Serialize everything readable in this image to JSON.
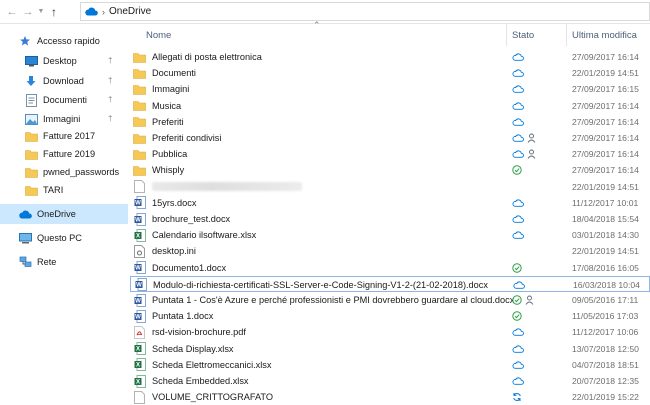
{
  "address": {
    "path": "OneDrive"
  },
  "sidebar": {
    "items": [
      {
        "label": "Accesso rapido",
        "icon": "star-icon"
      },
      {
        "label": "Desktop",
        "icon": "desktop-icon",
        "pinned": true
      },
      {
        "label": "Download",
        "icon": "download-icon",
        "pinned": true
      },
      {
        "label": "Documenti",
        "icon": "documents-icon",
        "pinned": true
      },
      {
        "label": "Immagini",
        "icon": "pictures-icon",
        "pinned": true
      },
      {
        "label": "Fatture 2017",
        "icon": "folder-icon"
      },
      {
        "label": "Fatture 2019",
        "icon": "folder-icon"
      },
      {
        "label": "pwned_passwords",
        "icon": "folder-icon"
      },
      {
        "label": "TARI",
        "icon": "folder-icon"
      },
      {
        "label": "OneDrive",
        "icon": "cloud-icon",
        "selected": true
      },
      {
        "label": "Questo PC",
        "icon": "computer-icon"
      },
      {
        "label": "Rete",
        "icon": "network-icon"
      }
    ]
  },
  "columns": {
    "name": "Nome",
    "state": "Stato",
    "modified": "Ultima modifica"
  },
  "files": [
    {
      "name": "Allegati di posta elettronica",
      "type": "folder",
      "state": [
        "cloud"
      ],
      "date": "27/09/2017 16:14"
    },
    {
      "name": "Documenti",
      "type": "folder",
      "state": [
        "cloud"
      ],
      "date": "22/01/2019 14:51"
    },
    {
      "name": "Immagini",
      "type": "folder",
      "state": [
        "cloud"
      ],
      "date": "27/09/2017 16:15"
    },
    {
      "name": "Musica",
      "type": "folder",
      "state": [
        "cloud"
      ],
      "date": "27/09/2017 16:14"
    },
    {
      "name": "Preferiti",
      "type": "folder",
      "state": [
        "cloud"
      ],
      "date": "27/09/2017 16:14"
    },
    {
      "name": "Preferiti condivisi",
      "type": "folder",
      "state": [
        "cloud",
        "shared"
      ],
      "date": "27/09/2017 16:14"
    },
    {
      "name": "Pubblica",
      "type": "folder",
      "state": [
        "cloud",
        "shared"
      ],
      "date": "27/09/2017 16:14"
    },
    {
      "name": "Whisply",
      "type": "folder",
      "state": [
        "synced"
      ],
      "date": "27/09/2017 16:14"
    },
    {
      "name": "",
      "type": "blank",
      "redacted": true,
      "state": [],
      "date": "22/01/2019 14:51"
    },
    {
      "name": "15yrs.docx",
      "type": "word",
      "state": [
        "cloud"
      ],
      "date": "11/12/2017 10:01"
    },
    {
      "name": "brochure_test.docx",
      "type": "word",
      "state": [
        "cloud"
      ],
      "date": "18/04/2018 15:54"
    },
    {
      "name": "Calendario ilsoftware.xlsx",
      "type": "excel",
      "state": [
        "cloud"
      ],
      "date": "03/01/2018 14:30"
    },
    {
      "name": "desktop.ini",
      "type": "ini",
      "state": [],
      "date": "22/01/2019 14:51"
    },
    {
      "name": "Documento1.docx",
      "type": "word",
      "state": [
        "synced"
      ],
      "date": "17/08/2016 16:05"
    },
    {
      "name": "Modulo-di-richiesta-certificati-SSL-Server-e-Code-Signing-V1-2-(21-02-2018).docx",
      "type": "word",
      "state": [
        "cloud"
      ],
      "date": "16/03/2018 10:04",
      "focused": true
    },
    {
      "name": "Puntata 1 - Cos'è Azure e perché professionisti e PMI dovrebbero guardare al cloud.docx",
      "type": "word",
      "state": [
        "synced",
        "shared"
      ],
      "date": "09/05/2016 17:11"
    },
    {
      "name": "Puntata 1.docx",
      "type": "word",
      "state": [
        "synced"
      ],
      "date": "11/05/2016 17:03"
    },
    {
      "name": "rsd-vision-brochure.pdf",
      "type": "pdf",
      "state": [
        "cloud"
      ],
      "date": "11/12/2017 10:06"
    },
    {
      "name": "Scheda Display.xlsx",
      "type": "excel",
      "state": [
        "cloud"
      ],
      "date": "13/07/2018 12:50"
    },
    {
      "name": "Scheda Elettromeccanici.xlsx",
      "type": "excel",
      "state": [
        "cloud"
      ],
      "date": "04/07/2018 18:51"
    },
    {
      "name": "Scheda Embedded.xlsx",
      "type": "excel",
      "state": [
        "cloud"
      ],
      "date": "20/07/2018 12:35"
    },
    {
      "name": "VOLUME_CRITTOGRAFATO",
      "type": "blank",
      "state": [
        "syncing"
      ],
      "date": "22/01/2019 15:22"
    }
  ],
  "colors": {
    "accent": "#0078d7",
    "folder": "#f5c955",
    "synced": "#2e9d48",
    "word": "#2b579a",
    "excel": "#217346",
    "pdf": "#d42a2a",
    "selected": "#cce8ff"
  }
}
